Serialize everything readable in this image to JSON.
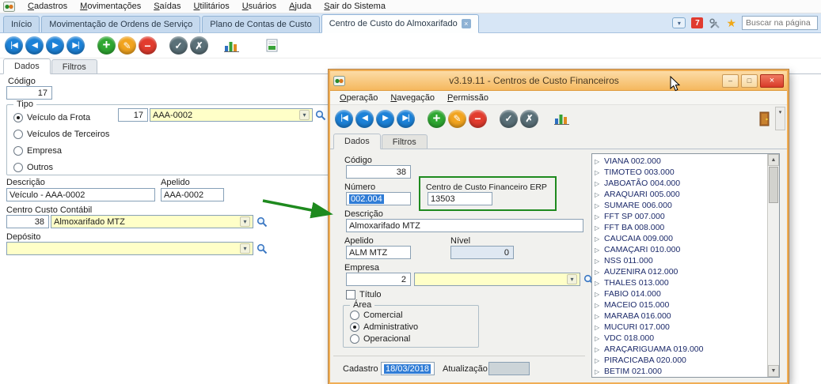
{
  "menubar": {
    "items": [
      "Cadastros",
      "Movimentações",
      "Saídas",
      "Utilitários",
      "Usuários",
      "Ajuda",
      "Sair do Sistema"
    ]
  },
  "tabbar": {
    "tabs": [
      {
        "label": "Início"
      },
      {
        "label": "Movimentação de Ordens de Serviço"
      },
      {
        "label": "Plano de Contas de Custo"
      },
      {
        "label": "Centro de Custo do Almoxarifado",
        "active": true,
        "closable": true
      }
    ],
    "notification_count": "7",
    "search_placeholder": "Buscar na página"
  },
  "main": {
    "subtabs": [
      {
        "label": "Dados",
        "active": true
      },
      {
        "label": "Filtros"
      }
    ],
    "codigo": {
      "label": "Código",
      "value": "17"
    },
    "tipo": {
      "label": "Tipo",
      "options": [
        {
          "label": "Veículo da Frota",
          "checked": true
        },
        {
          "label": "Veículos de Terceiros"
        },
        {
          "label": "Empresa"
        },
        {
          "label": "Outros"
        }
      ],
      "veiculo_codigo": "17",
      "veiculo_placa": "AAA-0002"
    },
    "descricao": {
      "label": "Descrição",
      "value": "Veículo - AAA-0002"
    },
    "apelido": {
      "label": "Apelido",
      "value": "AAA-0002"
    },
    "centro_custo_contabil": {
      "label": "Centro Custo Contábil",
      "codigo": "38",
      "nome": "Almoxarifado MTZ"
    },
    "deposito": {
      "label": "Depósito",
      "value": ""
    }
  },
  "dialog": {
    "title": "v3.19.11 - Centros de Custo Financeiros",
    "menu": [
      "Operação",
      "Navegação",
      "Permissão"
    ],
    "subtabs": [
      {
        "label": "Dados",
        "active": true
      },
      {
        "label": "Filtros"
      }
    ],
    "codigo": {
      "label": "Código",
      "value": "38"
    },
    "numero": {
      "label": "Número",
      "value": "002.004"
    },
    "ccf_erp": {
      "label": "Centro de Custo Financeiro ERP",
      "value": "13503"
    },
    "descricao": {
      "label": "Descrição",
      "value": "Almoxarifado MTZ"
    },
    "apelido": {
      "label": "Apelido",
      "value": "ALM MTZ"
    },
    "nivel": {
      "label": "Nível",
      "value": "0"
    },
    "empresa": {
      "label": "Empresa",
      "codigo": "2",
      "nome": ""
    },
    "titulo": {
      "label": "Título"
    },
    "area": {
      "label": "Área",
      "options": [
        {
          "label": "Comercial"
        },
        {
          "label": "Administrativo",
          "checked": true
        },
        {
          "label": "Operacional"
        }
      ]
    },
    "cadastro": {
      "label": "Cadastro",
      "value": "18/03/2018"
    },
    "atualizacao": {
      "label": "Atualização",
      "value": ""
    },
    "tree": [
      "VIANA 002.000",
      "TIMOTEO 003.000",
      "JABOATÃO 004.000",
      "ARAQUARI 005.000",
      "SUMARE 006.000",
      "FFT SP 007.000",
      "FFT BA 008.000",
      "CAUCAIA 009.000",
      "CAMAÇARI 010.000",
      "NSS 011.000",
      "AUZENIRA 012.000",
      "THALES 013.000",
      "FABIO 014.000",
      "MACEIO 015.000",
      "MARABA 016.000",
      "MUCURI 017.000",
      "VDC 018.000",
      "ARAÇARIGUAMA 019.000",
      "PIRACICABA 020.000",
      "BETIM 021.000"
    ]
  },
  "icons": {
    "first": "|◀",
    "prev": "◀",
    "next": "▶",
    "last": "▶|",
    "add": "+",
    "edit": "✎",
    "delete": "−",
    "confirm": "✓",
    "cancel": "✗",
    "dropdown": "▾",
    "up": "▲",
    "down": "▼",
    "close": "×",
    "minimize": "–",
    "maximize": "□",
    "star": "★",
    "tree_expand": "▷",
    "tab_close": "×",
    "panel_chevron": "▾"
  },
  "colors": {
    "titlebar_orange": "#f6bc66",
    "nav_blue": "#1c82d8",
    "add_green": "#2fa832",
    "edit_orange": "#f2a41f",
    "delete_red": "#e23c2e",
    "field_yellow": "#ffffc8",
    "selection_blue": "#2f7cd6",
    "annotation_green": "#1e8a1e",
    "tab_strip_blue": "#d7e6f6",
    "badge_red": "#e03b30"
  }
}
